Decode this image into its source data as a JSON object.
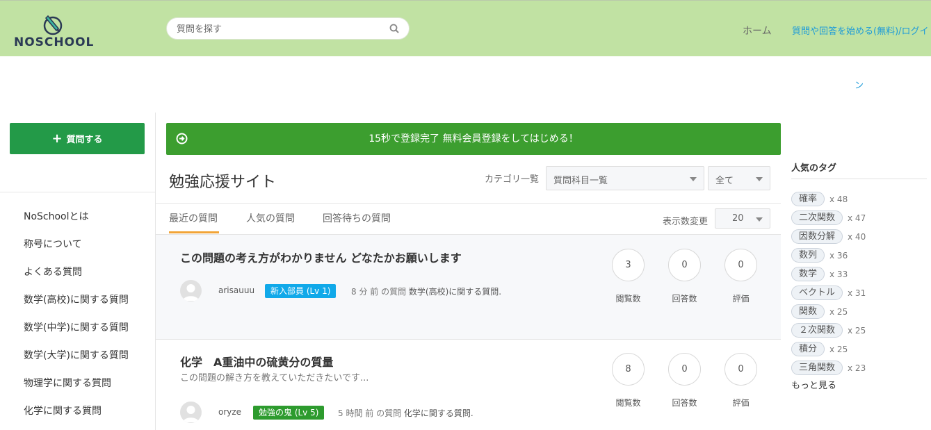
{
  "header": {
    "logo_text": "NOSCHOOL",
    "search_placeholder": "質問を探す",
    "nav_home": "ホーム",
    "nav_login": "質問や回答を始める(無料)/ログイ",
    "stray_text": "ン"
  },
  "sidebar": {
    "ask_label": "質問する",
    "items": [
      "NoSchoolとは",
      "称号について",
      "よくある質問",
      "数学(高校)に関する質問",
      "数学(中学)に関する質問",
      "数学(大学)に関する質問",
      "物理学に関する質問",
      "化学に関する質問"
    ]
  },
  "main": {
    "banner": "15秒で登録完了 無料会員登録をしてはじめる！",
    "title": "勉強応援サイト",
    "category_label": "カテゴリ一覧",
    "subject_select": "質問科目一覧",
    "scope_select": "全て",
    "tabs": [
      "最近の質問",
      "人気の質問",
      "回答待ちの質問"
    ],
    "display_count_label": "表示数変更",
    "display_count": "20"
  },
  "questions": [
    {
      "title": "この問題の考え方がわかりません どなたかお願いします",
      "desc": "",
      "user": "arisauuu",
      "badge": "新入部員 (Lv 1)",
      "badge_color": "#11a9e9",
      "ago": "8 分 前 の質問",
      "subject": "数学(高校)に関する質問.",
      "views": "3",
      "answers": "0",
      "rating": "0"
    },
    {
      "title": "化学　A重油中の硫黄分の質量",
      "desc": "この問題の解き方を教えていただきたいです...",
      "user": "oryze",
      "badge": "勉強の鬼 (Lv 5)",
      "badge_color": "#2d9b2e",
      "ago": "5 時間 前 の質問",
      "subject": "化学に関する質問.",
      "views": "8",
      "answers": "0",
      "rating": "0"
    }
  ],
  "stat_labels": {
    "views": "閲覧数",
    "answers": "回答数",
    "rating": "評価"
  },
  "tags": {
    "title": "人気のタグ",
    "items": [
      {
        "name": "確率",
        "count": "x 48"
      },
      {
        "name": "二次関数",
        "count": "x 47"
      },
      {
        "name": "因数分解",
        "count": "x 40"
      },
      {
        "name": "数列",
        "count": "x 36"
      },
      {
        "name": "数学",
        "count": "x 33"
      },
      {
        "name": "ベクトル",
        "count": "x 31"
      },
      {
        "name": "関数",
        "count": "x 25"
      },
      {
        "name": "２次関数",
        "count": "x 25"
      },
      {
        "name": "積分",
        "count": "x 25"
      },
      {
        "name": "三角関数",
        "count": "x 23"
      }
    ],
    "more": "もっと見る"
  },
  "colors": {
    "header_bg": "#c1e2a3",
    "ask_button": "#239a48",
    "banner": "#3c9e2f",
    "tab_accent": "#f2a436",
    "link": "#1d9bd8"
  }
}
